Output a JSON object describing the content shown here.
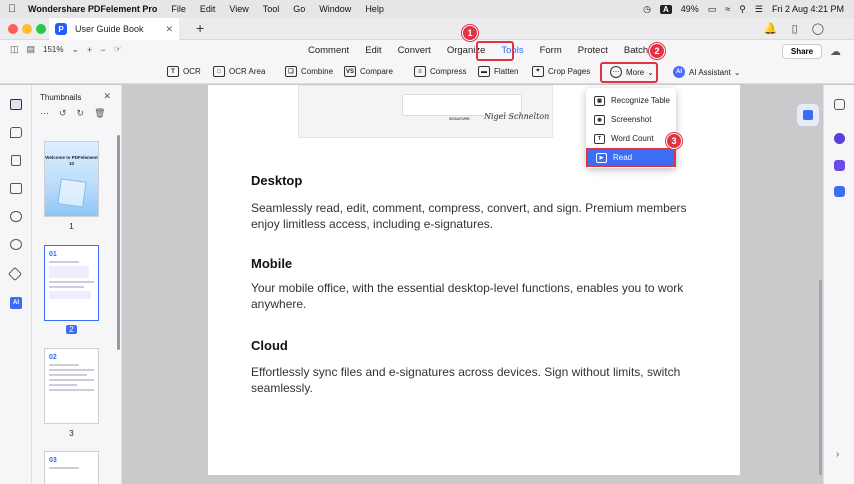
{
  "menubar": {
    "app_name": "Wondershare PDFelement Pro",
    "items": [
      "File",
      "Edit",
      "View",
      "Tool",
      "Go",
      "Window",
      "Help"
    ],
    "battery": "49%",
    "input_badge": "A",
    "datetime": "Fri 2 Aug  4:21 PM"
  },
  "tabbar": {
    "doc_tab": "User Guide Book",
    "logo_letter": "P",
    "new_tab": "+"
  },
  "toolbar": {
    "zoom": "151%",
    "menus": [
      "Comment",
      "Edit",
      "Convert",
      "Organize",
      "Tools",
      "Form",
      "Protect",
      "Batch"
    ],
    "active_menu": "Tools",
    "share_label": "Share"
  },
  "subbar": {
    "tools": [
      "OCR",
      "OCR Area",
      "Combine",
      "Compare",
      "Compress",
      "Flatten",
      "Crop Pages",
      "More",
      "AI Assistant"
    ],
    "ai_badge": "AI"
  },
  "thumbnails": {
    "header": "Thumbnails",
    "pages": [
      {
        "label": "1",
        "title": "Welcome to PDFelement 10"
      },
      {
        "label": "2",
        "number": "01"
      },
      {
        "label": "3",
        "number": "02"
      },
      {
        "label": "",
        "number": "03"
      }
    ]
  },
  "document": {
    "sections": [
      {
        "heading": "Desktop",
        "body": "Seamlessly read, edit, comment, compress, convert, and sign. Premium members enjoy limitless access, including e-signatures."
      },
      {
        "heading": "Mobile",
        "body": "Your mobile office, with the essential desktop-level functions, enables you to work anywhere."
      },
      {
        "heading": "Cloud",
        "body": "Effortlessly sync files and e-signatures across devices. Sign without limits, switch seamlessly."
      }
    ],
    "snippet": {
      "signature_label": "SIGNATURE:",
      "signature": "Nigel Schnelton"
    }
  },
  "more_menu": {
    "items": [
      "Recognize Table",
      "Screenshot",
      "Word Count",
      "Read"
    ],
    "highlighted": "Read"
  },
  "annotations": [
    "1",
    "2",
    "3"
  ],
  "left_rail": {
    "ai_label": "AI"
  },
  "colors": {
    "accent": "#3b6df5",
    "annotation": "#e03344"
  }
}
